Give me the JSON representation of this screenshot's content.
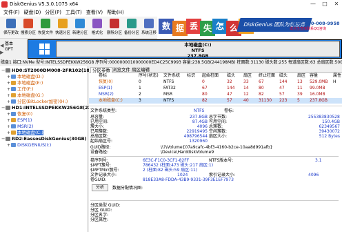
{
  "window": {
    "title": "DiskGenius V5.3.0.1075 x64",
    "minimize": "—",
    "maximize": "□",
    "close": "✕"
  },
  "menu": [
    "文件(F)",
    "硬盘(D)",
    "分区(P)",
    "工具(T)",
    "查看(V)",
    "帮助(H)"
  ],
  "toolbar": [
    {
      "label": "保存更改",
      "icon": "save-icon",
      "color": "#3c6fb8"
    },
    {
      "label": "搜索分区",
      "icon": "search-partition-icon",
      "color": "#d84a2a"
    },
    {
      "label": "恢复文件",
      "icon": "recover-files-icon",
      "color": "#2e9a3c"
    },
    {
      "label": "快速分区",
      "icon": "quick-partition-icon",
      "color": "#e7a020"
    },
    {
      "label": "新建分区",
      "icon": "new-partition-icon",
      "color": "#2f8ad6"
    },
    {
      "label": "格式化",
      "icon": "format-icon",
      "color": "#8a56c2"
    },
    {
      "label": "删除分区",
      "icon": "delete-partition-icon",
      "color": "#c53030"
    },
    {
      "label": "备份分区",
      "icon": "backup-partition-icon",
      "color": "#2a9a8a"
    },
    {
      "label": "系统迁移",
      "icon": "migrate-system-icon",
      "color": "#4f6fc0"
    }
  ],
  "ad": {
    "tiles": [
      {
        "text": "数",
        "color": "#3b5bb5"
      },
      {
        "text": "据",
        "color": "#e87b20"
      },
      {
        "text": "丢",
        "color": "#e34040"
      },
      {
        "text": "失",
        "color": "#2e9e4a"
      },
      {
        "text": "怎",
        "color": "#1a7fc9"
      },
      {
        "text": "么",
        "color": "#d23535"
      },
      {
        "text": "办",
        "color": "#f0a020"
      }
    ],
    "brand": "DiskGenius 团队为您服务",
    "phone": "服务: 400-008-9958",
    "sub": "或点击直接联系QQ咨询"
  },
  "disk_nav": {
    "label_top": "基本",
    "label_bottom": "GPT"
  },
  "partition_block": {
    "name": "本地磁盘(C:)",
    "fs": "NTFS",
    "size": "237.8GB",
    "color": "#1d7be2"
  },
  "disk_info": "磁盘1 接口:NVMe 型号:INTELSSDPEKKW256G8 序列号:0000000010000000ED4C25C9993 容量:238.5GB(244198MB) 柱面数:31130 磁头数:255 每道扇区数:63 总扇区数:500118",
  "tree": {
    "disks": [
      {
        "name": "HD0:ST2000DM008-2FR102(1863GB)",
        "parts": [
          "本地磁盘(D:)",
          "本地磁盘(E:)",
          "工作(F:)",
          "本地磁盘(G:)",
          "分区(BitLocker加密)(H:)"
        ]
      },
      {
        "name": "HD1:INTELSSDPEKKW256G8(238GB)",
        "parts": [
          "恢复(0)",
          "ESP(1)",
          "MSR(2)",
          "本地磁盘(C:)"
        ]
      },
      {
        "name": "RD2:EassosDiskGenius(30GB)",
        "parts": [
          "DISKGENIUS(I:)"
        ]
      }
    ]
  },
  "tabs": [
    "分区参数",
    "浏览文件",
    "扇区编辑"
  ],
  "partition_table": {
    "headers": [
      "卷标",
      "序号(状态)",
      "文件系统",
      "标识",
      "起始柱面",
      "磁头",
      "扇区",
      "终止柱面",
      "磁头",
      "扇区",
      "容量",
      "属性"
    ],
    "rows": [
      [
        "恢复(0)",
        "0",
        "NTFS",
        "",
        "0",
        "32",
        "33",
        "67",
        "144",
        "13",
        "529.0MB",
        "H"
      ],
      [
        "ESP(1)",
        "1",
        "FAT32",
        "",
        "67",
        "144",
        "14",
        "80",
        "47",
        "11",
        "99.0MB",
        ""
      ],
      [
        "MSR(2)",
        "2",
        "MSR",
        "",
        "80",
        "47",
        "12",
        "82",
        "57",
        "39",
        "16.0MB",
        ""
      ],
      [
        "本地磁盘(C:)",
        "3",
        "NTFS",
        "",
        "82",
        "57",
        "40",
        "31130",
        "223",
        "5",
        "237.8GB",
        ""
      ]
    ]
  },
  "details": {
    "fs_type_label": "文件系统类型:",
    "fs_type": "NTFS",
    "label_label": "卷标:",
    "left_rows": [
      [
        "总容量:",
        "237.8GB"
      ],
      [
        "已用空间:",
        "87.4GB"
      ],
      [
        "簇大小:",
        "4096"
      ],
      [
        "已用簇数:",
        "22919495"
      ],
      [
        "总扇区数:",
        "498796544"
      ],
      [
        "起始扇区号:",
        "1320960"
      ]
    ],
    "right_rows": [
      [
        "总字节数:",
        "255383830528"
      ],
      [
        "可用空间:",
        "150.4GB"
      ],
      [
        "总簇数:",
        "62349567"
      ],
      [
        "空闲簇数:",
        "39430072"
      ],
      [
        "扇区大小:",
        "512 Bytes"
      ],
      [
        "",
        ""
      ]
    ],
    "guid_path_label": "GUID路径:",
    "guid_path": "\\\\?\\Volume{07a9cafc-4bf3-4160-b2ce-10aa8d991afb}",
    "device_path_label": "设备路径:",
    "device_path": "\\Device\\HarddiskVolume9",
    "serial_label": "卷序列号:",
    "serial": "6E3C-F1C0-3CF1-82FF",
    "ntfs_ver_label": "NTFS版本号:",
    "ntfs_ver": "3.1",
    "mft_label": "$MFT簇号:",
    "mft": "786432 (柱面:473 磁头:217 扇区:1)",
    "mftmirr_label": "$MFTMirr簇号:",
    "mftmirr": "2 (柱面:82 磁头:59 扇区:11)",
    "record_label": "文件记录大小:",
    "record": "1024",
    "index_label": "索引记录大小:",
    "index": "4096",
    "vol_guid_label": "卷GUID:",
    "vol_guid": "818E33A8-FDDA-43B9-9331-39F3E1EF7973",
    "analyze_button": "分析",
    "alloc_label": "数据分配情况图:",
    "type_guid_label": "分区类型 GUID:",
    "part_guid_label": "分区 GUID:",
    "part_name_label": "分区名字:",
    "part_attr_label": "分区属性:"
  }
}
